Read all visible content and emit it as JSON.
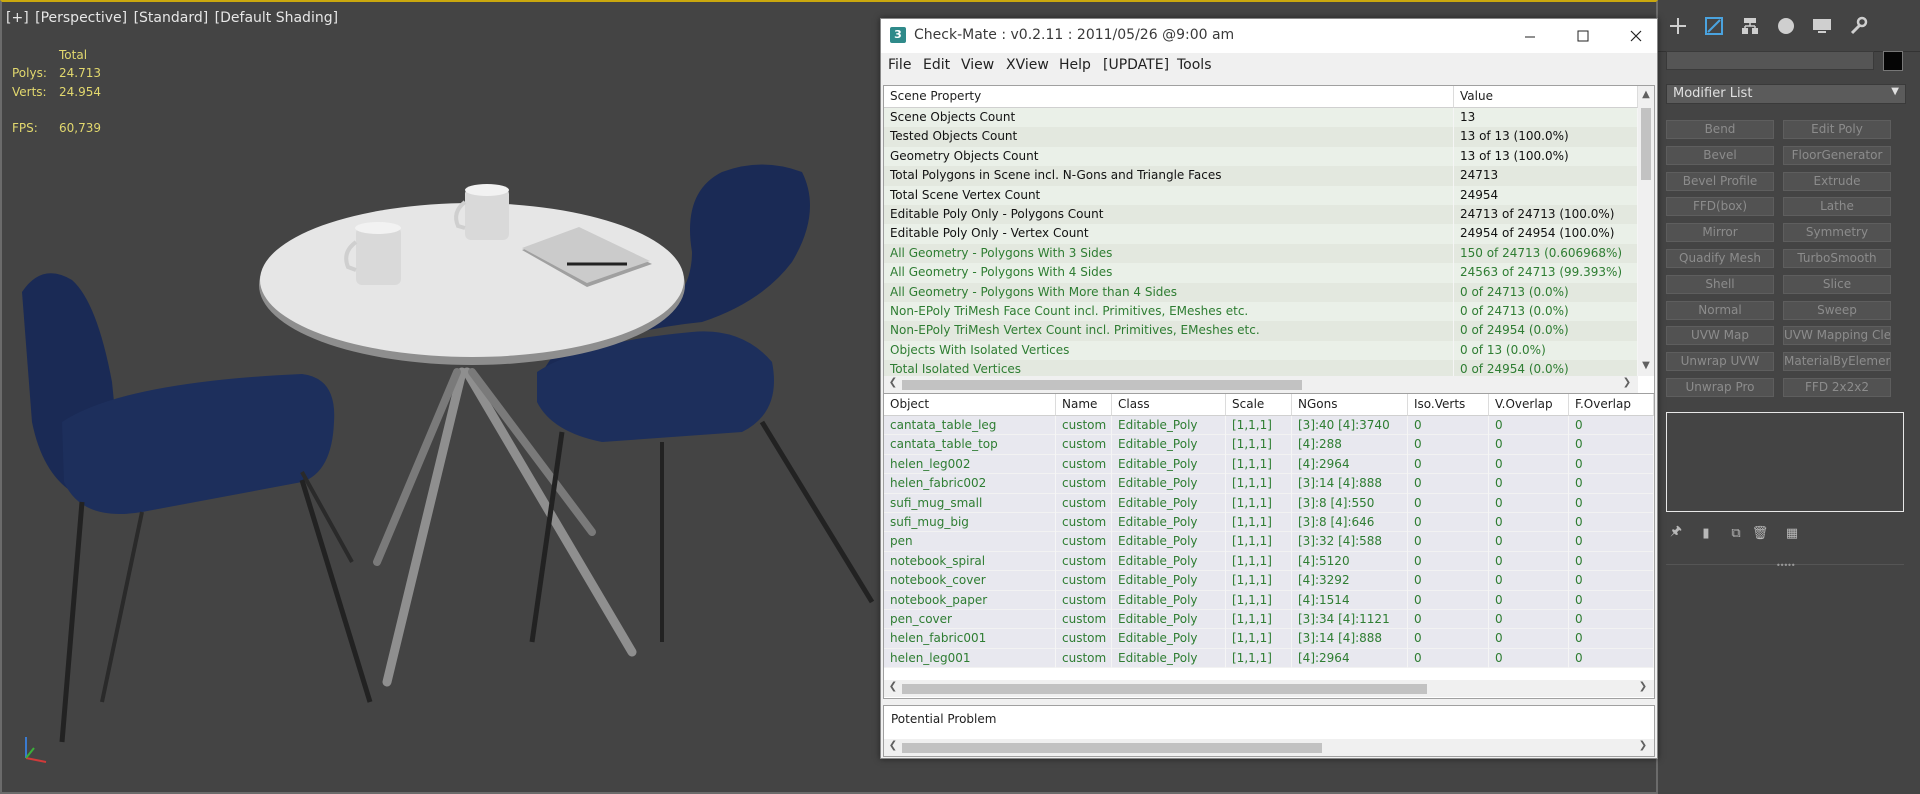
{
  "viewport": {
    "labels": [
      "[+]",
      "[Perspective]",
      "[Standard]",
      "[Default Shading]"
    ],
    "stats": {
      "header": "Total",
      "polys_label": "Polys:",
      "polys_value": "24.713",
      "verts_label": "Verts:",
      "verts_value": "24.954",
      "fps_label": "FPS:",
      "fps_value": "60,739"
    }
  },
  "command_panel": {
    "tabs": [
      "create-icon",
      "modify-icon",
      "hierarchy-icon",
      "motion-icon",
      "display-icon",
      "utilities-icon"
    ],
    "modifier_list_label": "Modifier List",
    "buttons": [
      "Bend",
      "Edit Poly",
      "Bevel",
      "FloorGenerator",
      "Bevel Profile",
      "Extrude",
      "FFD(box)",
      "Lathe",
      "Mirror",
      "Symmetry",
      "Quadify Mesh",
      "TurboSmooth",
      "Shell",
      "Slice",
      "Normal",
      "Sweep",
      "UVW Map",
      "UVW Mapping Clear",
      "Unwrap UVW",
      "MaterialByElement",
      "Unwrap Pro",
      "FFD 2x2x2"
    ],
    "stack_tools": [
      "pin-stack-icon",
      "show-end-result-icon",
      "make-unique-icon",
      "remove-modifier-icon",
      "configure-modifier-sets-icon"
    ],
    "object_color": "#050505"
  },
  "checkmate": {
    "logo": "3",
    "title": "Check-Mate : v0.2.11 : 2011/05/26 @9:00 am",
    "menu": [
      "File",
      "Edit",
      "View",
      "XView",
      "Help",
      "[UPDATE]",
      "Tools"
    ],
    "colors": {
      "accent_green": "#2e7d32",
      "row_even": "#eaf0e8",
      "row_odd": "#e3e8df",
      "row_lav": "#e8e8ef"
    },
    "scene_table": {
      "headers": [
        "Scene Property",
        "Value"
      ],
      "rows": [
        {
          "property": "Scene Objects Count",
          "value": "13",
          "style": "black"
        },
        {
          "property": "Tested Objects Count",
          "value": "13 of 13 (100.0%)",
          "style": "black"
        },
        {
          "property": "Geometry Objects Count",
          "value": "13 of 13 (100.0%)",
          "style": "black"
        },
        {
          "property": "Total Polygons in Scene incl. N-Gons and Triangle Faces",
          "value": "24713",
          "style": "black"
        },
        {
          "property": "Total Scene Vertex Count",
          "value": "24954",
          "style": "black"
        },
        {
          "property": "Editable Poly Only - Polygons Count",
          "value": "24713 of 24713 (100.0%)",
          "style": "black"
        },
        {
          "property": "Editable Poly Only - Vertex Count",
          "value": "24954 of 24954 (100.0%)",
          "style": "black"
        },
        {
          "property": "All Geometry - Polygons With 3 Sides",
          "value": "150 of 24713 (0.606968%)",
          "style": "green"
        },
        {
          "property": "All Geometry - Polygons With 4 Sides",
          "value": "24563 of 24713 (99.393%)",
          "style": "green"
        },
        {
          "property": "All Geometry - Polygons With More than 4 Sides",
          "value": "0 of 24713 (0.0%)",
          "style": "green"
        },
        {
          "property": "Non-EPoly TriMesh Face Count incl. Primitives, EMeshes etc.",
          "value": "0 of 24713 (0.0%)",
          "style": "green"
        },
        {
          "property": "Non-EPoly TriMesh Vertex Count incl. Primitives, EMeshes etc.",
          "value": "0 of 24954 (0.0%)",
          "style": "green"
        },
        {
          "property": "Objects With Isolated Vertices",
          "value": "0 of 13 (0.0%)",
          "style": "green"
        },
        {
          "property": "Total Isolated Vertices",
          "value": "0 of 24954 (0.0%)",
          "style": "green"
        }
      ]
    },
    "object_table": {
      "headers": [
        "Object",
        "Name",
        "Class",
        "Scale",
        "NGons",
        "Iso.Verts",
        "V.Overlap",
        "F.Overlap"
      ],
      "rows": [
        [
          "cantata_table_leg",
          "custom",
          "Editable_Poly",
          "[1,1,1]",
          "[3]:40 [4]:3740",
          "0",
          "0",
          "0"
        ],
        [
          "cantata_table_top",
          "custom",
          "Editable_Poly",
          "[1,1,1]",
          "[4]:288",
          "0",
          "0",
          "0"
        ],
        [
          "helen_leg002",
          "custom",
          "Editable_Poly",
          "[1,1,1]",
          "[4]:2964",
          "0",
          "0",
          "0"
        ],
        [
          "helen_fabric002",
          "custom",
          "Editable_Poly",
          "[1,1,1]",
          "[3]:14 [4]:888",
          "0",
          "0",
          "0"
        ],
        [
          "sufi_mug_small",
          "custom",
          "Editable_Poly",
          "[1,1,1]",
          "[3]:8 [4]:550",
          "0",
          "0",
          "0"
        ],
        [
          "sufi_mug_big",
          "custom",
          "Editable_Poly",
          "[1,1,1]",
          "[3]:8 [4]:646",
          "0",
          "0",
          "0"
        ],
        [
          "pen",
          "custom",
          "Editable_Poly",
          "[1,1,1]",
          "[3]:32 [4]:588",
          "0",
          "0",
          "0"
        ],
        [
          "notebook_spiral",
          "custom",
          "Editable_Poly",
          "[1,1,1]",
          "[4]:5120",
          "0",
          "0",
          "0"
        ],
        [
          "notebook_cover",
          "custom",
          "Editable_Poly",
          "[1,1,1]",
          "[4]:3292",
          "0",
          "0",
          "0"
        ],
        [
          "notebook_paper",
          "custom",
          "Editable_Poly",
          "[1,1,1]",
          "[4]:1514",
          "0",
          "0",
          "0"
        ],
        [
          "pen_cover",
          "custom",
          "Editable_Poly",
          "[1,1,1]",
          "[3]:34 [4]:1121",
          "0",
          "0",
          "0"
        ],
        [
          "helen_fabric001",
          "custom",
          "Editable_Poly",
          "[1,1,1]",
          "[3]:14 [4]:888",
          "0",
          "0",
          "0"
        ],
        [
          "helen_leg001",
          "custom",
          "Editable_Poly",
          "[1,1,1]",
          "[4]:2964",
          "0",
          "0",
          "0"
        ]
      ]
    },
    "problem_label": "Potential Problem"
  }
}
